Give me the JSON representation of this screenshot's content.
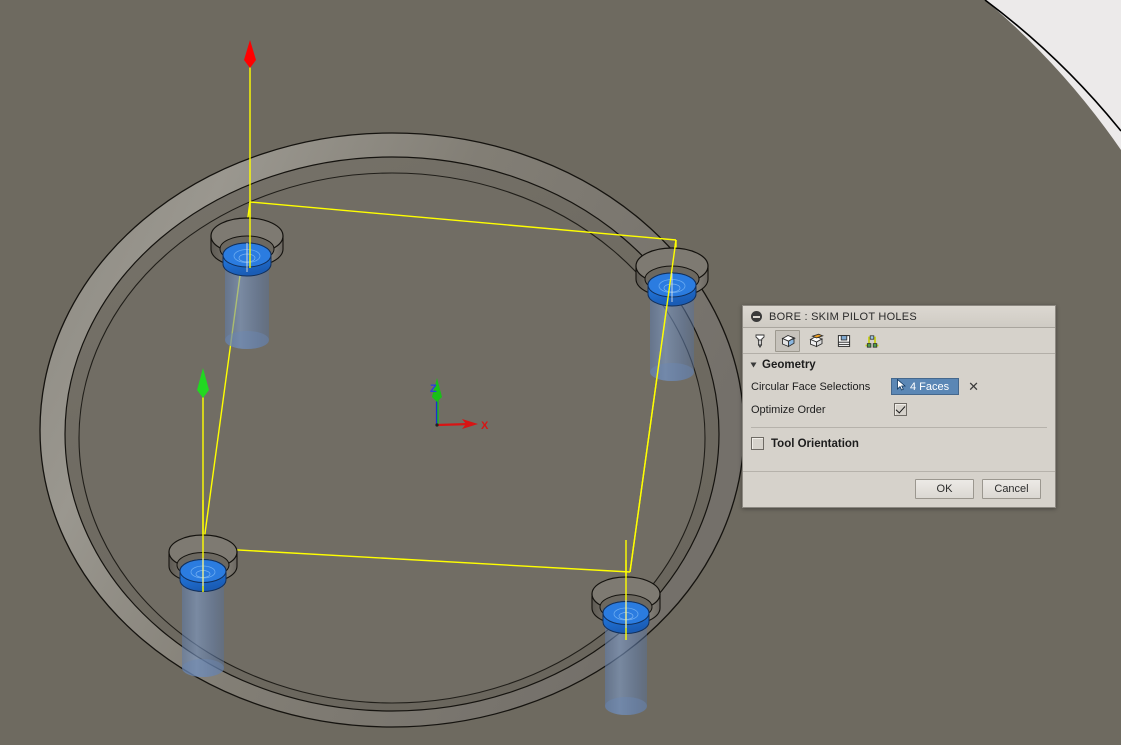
{
  "viewport": {
    "background_color": "#6e6a60",
    "part_name": "circular-plate-with-four-counterbored-holes",
    "fixture_arc_color": "#eceaea",
    "toolpath_color": "#ffff00",
    "rapid_arrow_colors": {
      "retract": "#ff0000",
      "plunge": "#00e000"
    },
    "selected_face_color": "#2878d8",
    "tool_cylinder_color": "#6f8fc0",
    "origin_triad": {
      "x_label": "X",
      "z_label": "Z",
      "x_color": "#d81414",
      "z_color": "#1f2fd0",
      "y_color": "#18c018"
    }
  },
  "dialog": {
    "title": "BORE : SKIM PILOT HOLES",
    "collapse_icon": "minus-circle-icon",
    "toolbar": [
      {
        "name": "tool-tab",
        "icon": "end-mill-tool-icon",
        "active": false
      },
      {
        "name": "geometry-tab",
        "icon": "geometry-cube-icon",
        "active": true
      },
      {
        "name": "heights-tab",
        "icon": "heights-cube-icon",
        "active": false
      },
      {
        "name": "passes-tab",
        "icon": "passes-icon",
        "active": false
      },
      {
        "name": "linking-tab",
        "icon": "linking-icon",
        "active": false
      }
    ],
    "geometry": {
      "section_label": "Geometry",
      "expanded": true,
      "rows": [
        {
          "label": "Circular Face Selections",
          "type": "selection",
          "value": "4 Faces",
          "icon": "selection-cursor-icon",
          "clear_label": "✕"
        },
        {
          "label": "Optimize Order",
          "type": "checkbox",
          "checked": true
        }
      ]
    },
    "tool_orientation": {
      "label": "Tool Orientation",
      "checked": false
    },
    "footer": {
      "ok_label": "OK",
      "cancel_label": "Cancel"
    }
  }
}
